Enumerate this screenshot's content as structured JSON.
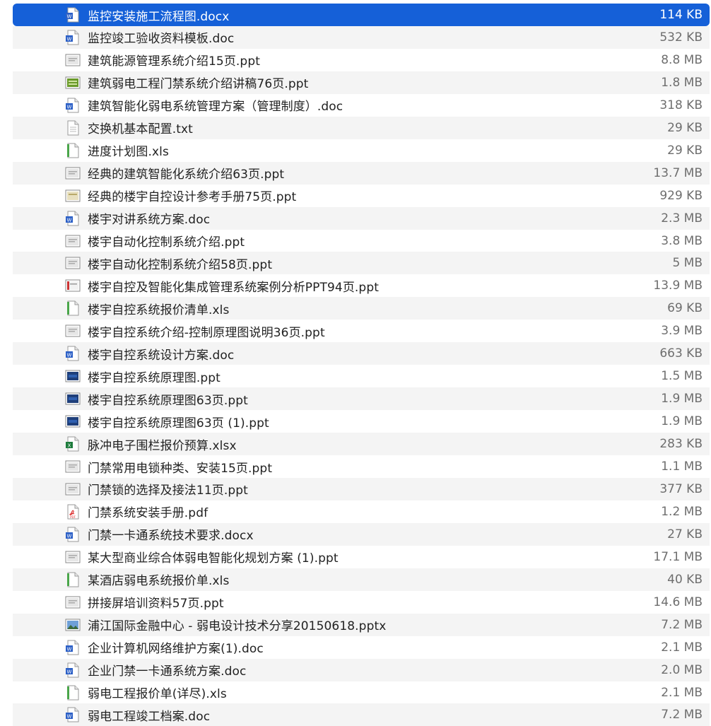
{
  "files": [
    {
      "name": "监控安装施工流程图.docx",
      "size": "114 KB",
      "icon": "word-doc-icon",
      "selected": true
    },
    {
      "name": "监控竣工验收资料模板.doc",
      "size": "532 KB",
      "icon": "word-doc-icon"
    },
    {
      "name": "建筑能源管理系统介绍15页.ppt",
      "size": "8.8 MB",
      "icon": "ppt-thumbnail-icon"
    },
    {
      "name": "建筑弱电工程门禁系统介绍讲稿76页.ppt",
      "size": "1.8 MB",
      "icon": "ppt-thumbnail-green-icon"
    },
    {
      "name": "建筑智能化弱电系统管理方案（管理制度）.doc",
      "size": "318 KB",
      "icon": "word-doc-icon"
    },
    {
      "name": "交换机基本配置.txt",
      "size": "29 KB",
      "icon": "text-file-icon"
    },
    {
      "name": "进度计划图.xls",
      "size": "29 KB",
      "icon": "spreadsheet-icon"
    },
    {
      "name": "经典的建筑智能化系统介绍63页.ppt",
      "size": "13.7 MB",
      "icon": "ppt-thumbnail-icon"
    },
    {
      "name": "经典的楼宇自控设计参考手册75页.ppt",
      "size": "929 KB",
      "icon": "ppt-thumbnail-beige-icon"
    },
    {
      "name": "楼宇对讲系统方案.doc",
      "size": "2.3 MB",
      "icon": "word-doc-icon"
    },
    {
      "name": "楼宇自动化控制系统介绍.ppt",
      "size": "3.8 MB",
      "icon": "ppt-thumbnail-icon"
    },
    {
      "name": "楼宇自动化控制系统介绍58页.ppt",
      "size": "5 MB",
      "icon": "ppt-thumbnail-icon"
    },
    {
      "name": "楼宇自控及智能化集成管理系统案例分析PPT94页.ppt",
      "size": "13.9 MB",
      "icon": "ppt-thumbnail-red-icon"
    },
    {
      "name": "楼宇自控系统报价清单.xls",
      "size": "69 KB",
      "icon": "spreadsheet-icon"
    },
    {
      "name": "楼宇自控系统介绍-控制原理图说明36页.ppt",
      "size": "3.9 MB",
      "icon": "ppt-thumbnail-icon"
    },
    {
      "name": "楼宇自控系统设计方案.doc",
      "size": "663 KB",
      "icon": "word-doc-icon"
    },
    {
      "name": "楼宇自控系统原理图.ppt",
      "size": "1.5 MB",
      "icon": "ppt-thumbnail-blue-icon"
    },
    {
      "name": "楼宇自控系统原理图63页.ppt",
      "size": "1.9 MB",
      "icon": "ppt-thumbnail-blue-icon"
    },
    {
      "name": "楼宇自控系统原理图63页 (1).ppt",
      "size": "1.9 MB",
      "icon": "ppt-thumbnail-blue-icon"
    },
    {
      "name": "脉冲电子围栏报价预算.xlsx",
      "size": "283 KB",
      "icon": "excel-icon"
    },
    {
      "name": "门禁常用电锁种类、安装15页.ppt",
      "size": "1.1 MB",
      "icon": "ppt-thumbnail-icon"
    },
    {
      "name": "门禁锁的选择及接法11页.ppt",
      "size": "377 KB",
      "icon": "ppt-thumbnail-icon"
    },
    {
      "name": "门禁系统安装手册.pdf",
      "size": "1.2 MB",
      "icon": "pdf-icon"
    },
    {
      "name": "门禁一卡通系统技术要求.docx",
      "size": "27 KB",
      "icon": "word-doc-icon"
    },
    {
      "name": "某大型商业综合体弱电智能化规划方案 (1).ppt",
      "size": "17.1 MB",
      "icon": "ppt-thumbnail-icon"
    },
    {
      "name": "某酒店弱电系统报价单.xls",
      "size": "40 KB",
      "icon": "spreadsheet-icon"
    },
    {
      "name": "拼接屏培训资料57页.ppt",
      "size": "14.6 MB",
      "icon": "ppt-thumbnail-icon"
    },
    {
      "name": "浦江国际金融中心 - 弱电设计技术分享20150618.pptx",
      "size": "7.2 MB",
      "icon": "ppt-thumbnail-photo-icon"
    },
    {
      "name": "企业计算机网络维护方案(1).doc",
      "size": "2.1 MB",
      "icon": "word-doc-icon"
    },
    {
      "name": "企业门禁一卡通系统方案.doc",
      "size": "2.0 MB",
      "icon": "word-doc-icon"
    },
    {
      "name": "弱电工程报价单(详尽).xls",
      "size": "2.1 MB",
      "icon": "spreadsheet-icon"
    },
    {
      "name": "弱电工程竣工档案.doc",
      "size": "7.2 MB",
      "icon": "word-doc-icon"
    }
  ]
}
